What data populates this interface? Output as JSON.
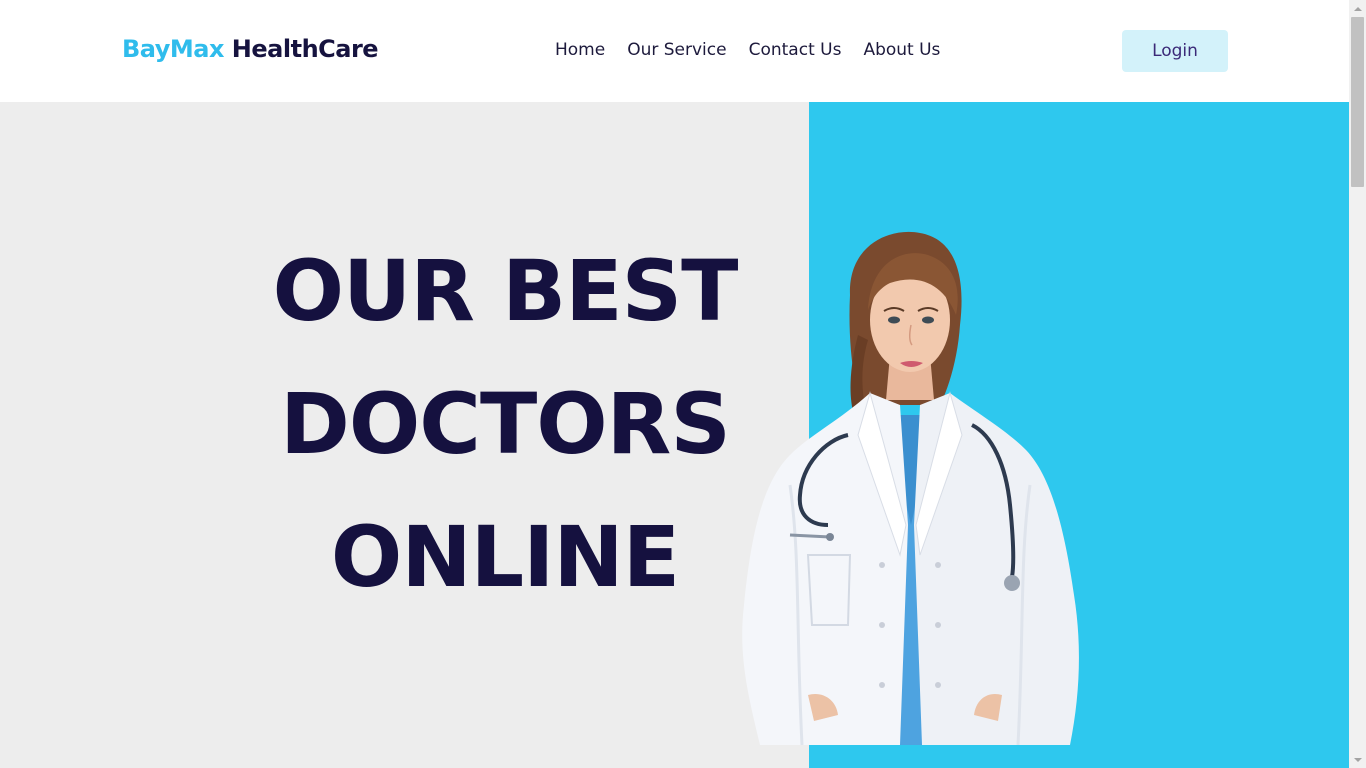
{
  "brand": {
    "part1": "BayMax",
    "part2": " HealthCare"
  },
  "nav": {
    "items": [
      "Home",
      "Our Service",
      "Contact Us",
      "About Us"
    ]
  },
  "header": {
    "login_label": "Login"
  },
  "hero": {
    "line1": "OUR BEST",
    "line2": "DOCTORS",
    "line3": "ONLINE"
  },
  "colors": {
    "accent": "#2fbcec",
    "dark": "#15113f",
    "hero_bg": "#ededed",
    "panel_bg": "#2ec8ee",
    "login_bg": "#d3f2fa"
  },
  "icons": {
    "scroll_up": "chevron-up-icon",
    "scroll_down": "chevron-down-icon"
  }
}
